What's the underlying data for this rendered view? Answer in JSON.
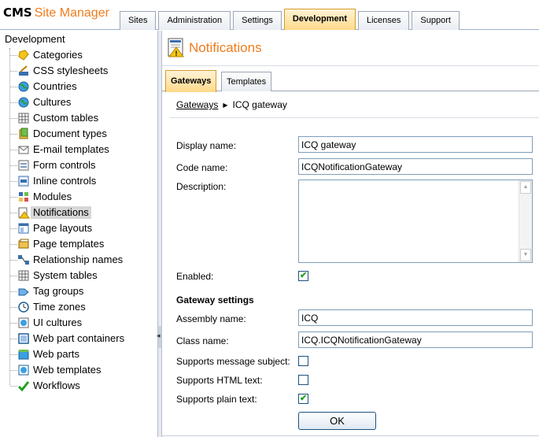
{
  "header": {
    "logo_cms": "CMS",
    "logo_sm": "Site Manager",
    "tabs": [
      {
        "label": "Sites"
      },
      {
        "label": "Administration"
      },
      {
        "label": "Settings"
      },
      {
        "label": "Development",
        "active": true
      },
      {
        "label": "Licenses"
      },
      {
        "label": "Support"
      }
    ]
  },
  "tree": {
    "root": "Development",
    "selected": "Notifications",
    "items": [
      {
        "label": "Categories",
        "icon": "categories-icon"
      },
      {
        "label": "CSS stylesheets",
        "icon": "css-stylesheets-icon"
      },
      {
        "label": "Countries",
        "icon": "globe-icon"
      },
      {
        "label": "Cultures",
        "icon": "globe-icon"
      },
      {
        "label": "Custom tables",
        "icon": "table-icon"
      },
      {
        "label": "Document types",
        "icon": "document-types-icon"
      },
      {
        "label": "E-mail templates",
        "icon": "email-icon"
      },
      {
        "label": "Form controls",
        "icon": "form-controls-icon"
      },
      {
        "label": "Inline controls",
        "icon": "inline-controls-icon"
      },
      {
        "label": "Modules",
        "icon": "modules-icon"
      },
      {
        "label": "Notifications",
        "icon": "notifications-icon"
      },
      {
        "label": "Page layouts",
        "icon": "page-layouts-icon"
      },
      {
        "label": "Page templates",
        "icon": "page-templates-icon"
      },
      {
        "label": "Relationship names",
        "icon": "relationship-icon"
      },
      {
        "label": "System tables",
        "icon": "table-icon"
      },
      {
        "label": "Tag groups",
        "icon": "tag-groups-icon"
      },
      {
        "label": "Time zones",
        "icon": "clock-icon"
      },
      {
        "label": "UI cultures",
        "icon": "ui-cultures-icon"
      },
      {
        "label": "Web part containers",
        "icon": "web-part-containers-icon"
      },
      {
        "label": "Web parts",
        "icon": "web-parts-icon"
      },
      {
        "label": "Web templates",
        "icon": "web-templates-icon"
      },
      {
        "label": "Workflows",
        "icon": "workflows-icon"
      }
    ]
  },
  "content": {
    "title": "Notifications",
    "subtabs": [
      {
        "label": "Gateways",
        "active": true
      },
      {
        "label": "Templates"
      }
    ],
    "breadcrumb": {
      "link": "Gateways",
      "current": "ICQ gateway"
    },
    "form": {
      "display_name_label": "Display name:",
      "display_name_value": "ICQ gateway",
      "code_name_label": "Code name:",
      "code_name_value": "ICQNotificationGateway",
      "description_label": "Description:",
      "description_value": "",
      "enabled_label": "Enabled:",
      "enabled": true,
      "gateway_settings_heading": "Gateway settings",
      "assembly_name_label": "Assembly name:",
      "assembly_name_value": "ICQ",
      "class_name_label": "Class name:",
      "class_name_value": "ICQ.ICQNotificationGateway",
      "supports_subject_label": "Supports message subject:",
      "supports_subject": false,
      "supports_html_label": "Supports HTML text:",
      "supports_html": false,
      "supports_plain_label": "Supports plain text:",
      "supports_plain": true,
      "ok_label": "OK"
    }
  },
  "colors": {
    "brand_orange": "#f07c1c",
    "active_tab": "#ffd98a",
    "input_border": "#7f9db9",
    "check_green": "#21a121"
  }
}
